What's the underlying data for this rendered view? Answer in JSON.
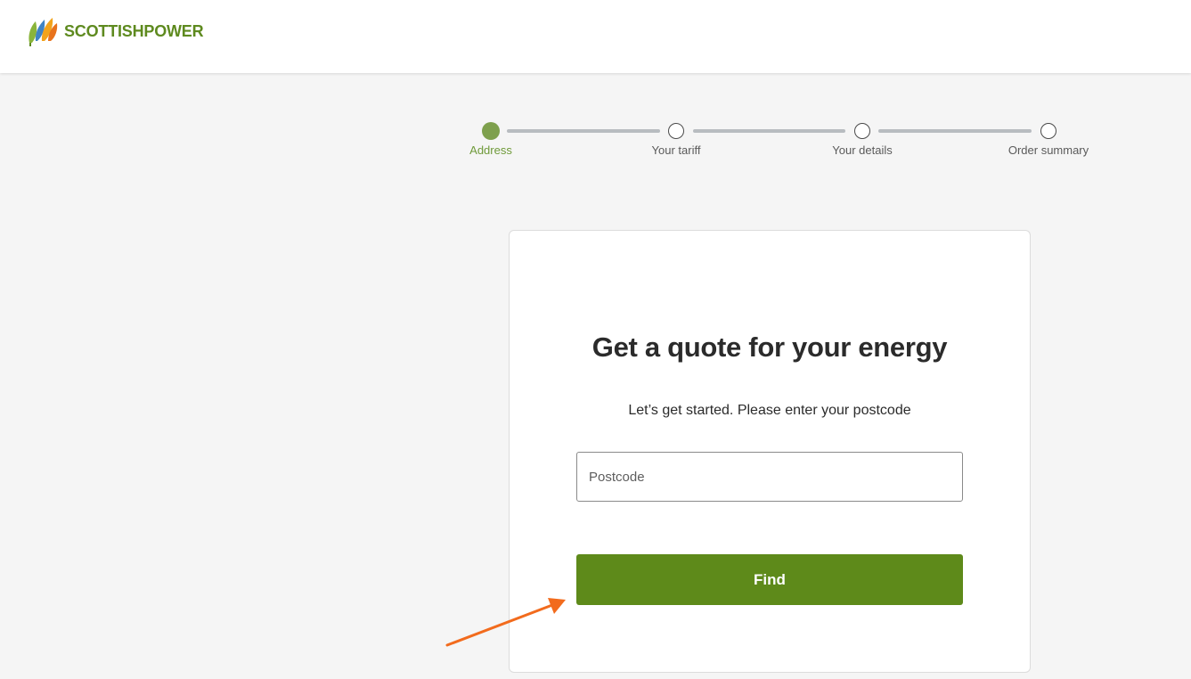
{
  "header": {
    "brand": "SCOTTISHPOWER",
    "brand_color": "#5e8a1f",
    "logo_icon": "leaves-logo-icon"
  },
  "stepper": {
    "steps": [
      {
        "label": "Address",
        "state": "active"
      },
      {
        "label": "Your tariff",
        "state": "pending"
      },
      {
        "label": "Your details",
        "state": "pending"
      },
      {
        "label": "Order summary",
        "state": "pending"
      }
    ],
    "active_color": "#7ea04d"
  },
  "card": {
    "title": "Get a quote for your energy",
    "subtitle": "Let’s get started. Please enter your postcode",
    "postcode": {
      "placeholder": "Postcode",
      "value": ""
    },
    "find_label": "Find",
    "find_color": "#5e8a1a"
  },
  "annotation": {
    "arrow_color": "#f26b1d",
    "arrow_icon": "arrow-annotation-icon"
  }
}
